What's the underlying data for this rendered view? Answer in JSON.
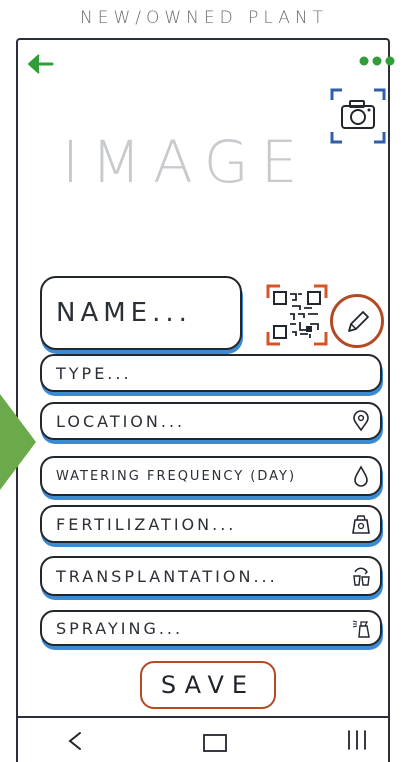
{
  "screen": {
    "title": "NEW/OWNED PLANT"
  },
  "header": {
    "back_icon": "arrow-left-icon",
    "menu_icon": "more-dots-icon",
    "camera_icon": "camera-icon",
    "image_placeholder": "IMAGE"
  },
  "form": {
    "name_placeholder": "NAME...",
    "type_placeholder": "TYPE...",
    "location_placeholder": "LOCATION...",
    "watering_placeholder": "WATERING FREQUENCY (DAY)",
    "fertilization_placeholder": "FERTILIZATION...",
    "transplantation_placeholder": "TRANSPLANTATION...",
    "spraying_placeholder": "SPRAYING...",
    "save_label": "SAVE"
  },
  "icons": {
    "location": "location-pin-icon",
    "watering": "water-drop-icon",
    "fertilization": "fertilizer-bag-icon",
    "transplantation": "pot-transplant-icon",
    "spraying": "spray-bottle-icon",
    "qr": "qr-code-icon",
    "edit": "pencil-icon"
  },
  "nav": {
    "back_icon": "nav-back-icon",
    "home_icon": "nav-home-icon",
    "recents_icon": "nav-recents-icon"
  },
  "colors": {
    "accent_green": "#2e9d3a",
    "arrow_green": "#6aaa4b",
    "field_underline_blue": "#3a8bd4",
    "save_border": "#b14a25",
    "qr_frame": "#d6542a"
  }
}
